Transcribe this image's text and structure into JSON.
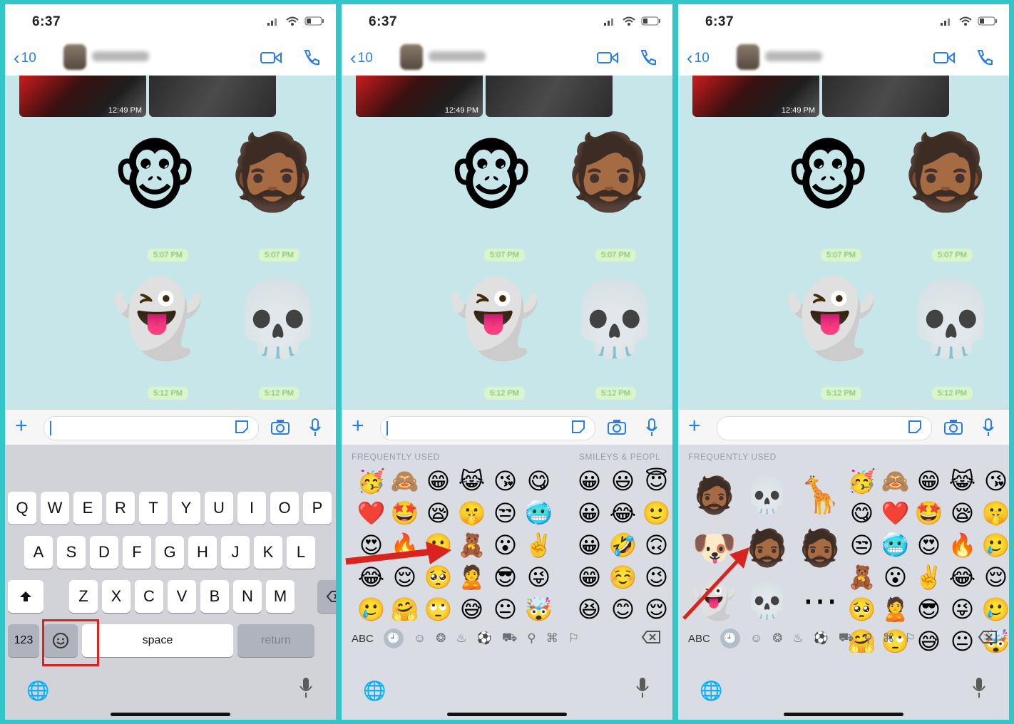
{
  "panels": [
    {
      "time": "6:37",
      "back_count": "10",
      "image_timestamp": "12:49 PM",
      "sticker_times": [
        "5:07 PM",
        "5:07 PM",
        "5:12 PM",
        "5:12 PM"
      ]
    },
    {
      "time": "6:37",
      "back_count": "10",
      "image_timestamp": "12:49 PM",
      "sticker_times": [
        "5:07 PM",
        "5:07 PM",
        "5:12 PM",
        "5:12 PM"
      ]
    },
    {
      "time": "6:37",
      "back_count": "10",
      "image_timestamp": "12:49 PM",
      "sticker_times": [
        "5:07 PM",
        "5:07 PM",
        "5:12 PM",
        "5:12 PM"
      ]
    }
  ],
  "stickers": [
    "🐵",
    "🧔🏾",
    "👻",
    "💀"
  ],
  "keyboard": {
    "row1": [
      "Q",
      "W",
      "E",
      "R",
      "T",
      "Y",
      "U",
      "I",
      "O",
      "P"
    ],
    "row2": [
      "A",
      "S",
      "D",
      "F",
      "G",
      "H",
      "J",
      "K",
      "L"
    ],
    "row3": [
      "Z",
      "X",
      "C",
      "V",
      "B",
      "N",
      "M"
    ],
    "key_123": "123",
    "space": "space",
    "return": "return"
  },
  "emoji_keyboard": {
    "frequently_used": "FREQUENTLY USED",
    "smileys_people": "SMILEYS & PEOPL",
    "abc": "ABC",
    "frequent_grid": [
      "🥳",
      "🙈",
      "😁",
      "😹",
      "😘",
      "😋",
      "❤️",
      "🤩",
      "😪",
      "🤫",
      "😒",
      "🥶",
      "😍",
      "🔥",
      "🥲",
      "🧸",
      "😮",
      "✌️",
      "😂",
      "😌",
      "🥺",
      "🙎",
      "😎",
      "😜",
      "🥲",
      "🤗",
      "🙄",
      "😅",
      "😐",
      "🤯"
    ],
    "smileys_grid": [
      "😀",
      "😃",
      "😇",
      "😀",
      "😂",
      "🙂",
      "😀",
      "🤣",
      "🙃",
      "😁",
      "☺️",
      "😉",
      "😆",
      "😊",
      "😌"
    ],
    "memoji_grid": [
      "🧔🏾",
      "💀",
      "🦒",
      "🐶",
      "🧔🏾",
      "🧔🏾",
      "👻",
      "💀",
      "⋯"
    ]
  },
  "colors": {
    "accent": "#2a7de1",
    "highlight": "#d8231f",
    "frame": "#33c6c9"
  }
}
